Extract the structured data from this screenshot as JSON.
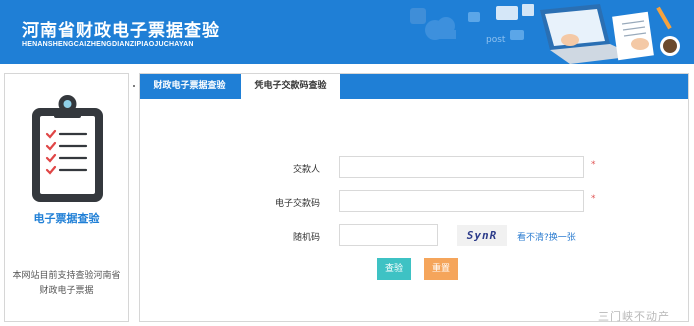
{
  "banner": {
    "title": "河南省财政电子票据查验",
    "subtitle": "HENANSHENGCAIZHENGDIANZIPIAOJUCHAYAN",
    "art_text": "post"
  },
  "left_panel": {
    "title": "电子票据查验",
    "note": "本网站目前支持查验河南省财政电子票据"
  },
  "tabs": [
    {
      "label": "财政电子票据查验",
      "active": false
    },
    {
      "label": "凭电子交款码查验",
      "active": true
    }
  ],
  "form": {
    "payer_label": "交款人",
    "payer_value": "",
    "payer_required": "*",
    "code_label": "电子交款码",
    "code_value": "",
    "code_required": "*",
    "random_label": "随机码",
    "random_value": "",
    "captcha_text": "SynR",
    "refresh_label": "看不清?换一张",
    "query_label": "查验",
    "reset_label": "重置"
  },
  "watermark": "三门峡不动产",
  "colors": {
    "brand_blue": "#1f7fd6",
    "query_button": "#3ec2c4",
    "reset_button": "#f5a55b",
    "required_star": "#e05555"
  },
  "icons": [
    "clipboard-checklist-icon",
    "laptop-icon",
    "coffee-cup-icon",
    "pencil-icon",
    "cloud-icon",
    "globe-icon"
  ]
}
